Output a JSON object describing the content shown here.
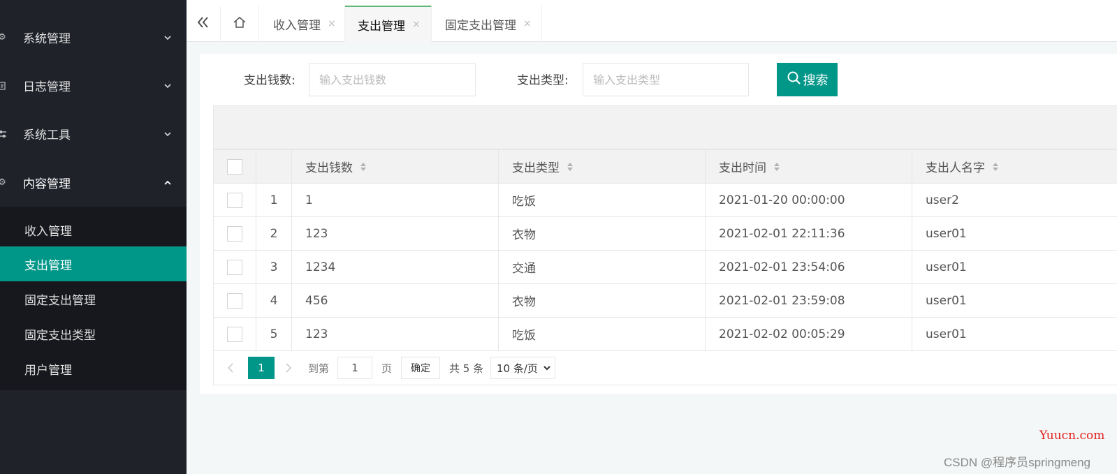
{
  "sidebar": {
    "menus": [
      {
        "label": "系统管理",
        "icon": "gear-icon",
        "expanded": false
      },
      {
        "label": "日志管理",
        "icon": "document-icon",
        "expanded": false
      },
      {
        "label": "系统工具",
        "icon": "sliders-icon",
        "expanded": false
      },
      {
        "label": "内容管理",
        "icon": "gear-icon",
        "expanded": true
      }
    ],
    "submenu": [
      {
        "label": "收入管理",
        "active": false
      },
      {
        "label": "支出管理",
        "active": true
      },
      {
        "label": "固定支出管理",
        "active": false
      },
      {
        "label": "固定支出类型",
        "active": false
      },
      {
        "label": "用户管理",
        "active": false
      }
    ]
  },
  "tabs": [
    {
      "label": "收入管理",
      "close": "×",
      "active": false
    },
    {
      "label": "支出管理",
      "close": "×",
      "active": true
    },
    {
      "label": "固定支出管理",
      "close": "×",
      "active": false
    }
  ],
  "search": {
    "amount_label": "支出钱数:",
    "amount_placeholder": "输入支出钱数",
    "type_label": "支出类型:",
    "type_placeholder": "输入支出类型",
    "button_label": "搜索"
  },
  "table": {
    "columns": [
      "支出钱数",
      "支出类型",
      "支出时间",
      "支出人名字"
    ],
    "rows": [
      {
        "no": "1",
        "amount": "1",
        "type": "吃饭",
        "time": "2021-01-20 00:00:00",
        "person": "user2"
      },
      {
        "no": "2",
        "amount": "123",
        "type": "衣物",
        "time": "2021-02-01 22:11:36",
        "person": "user01"
      },
      {
        "no": "3",
        "amount": "1234",
        "type": "交通",
        "time": "2021-02-01 23:54:06",
        "person": "user01"
      },
      {
        "no": "4",
        "amount": "456",
        "type": "衣物",
        "time": "2021-02-01 23:59:08",
        "person": "user01"
      },
      {
        "no": "5",
        "amount": "123",
        "type": "吃饭",
        "time": "2021-02-02 00:05:29",
        "person": "user01"
      }
    ]
  },
  "pager": {
    "current": "1",
    "goto_label": "到第",
    "goto_value": "1",
    "page_unit": "页",
    "confirm": "确定",
    "total": "共 5 条",
    "page_size": "10 条/页"
  },
  "watermarks": {
    "site": "Yuucn.com",
    "csdn": "CSDN @程序员springmeng"
  },
  "colors": {
    "accent": "#009688",
    "sidebar_bg": "#20222a",
    "watermark_red": "#e02020"
  }
}
